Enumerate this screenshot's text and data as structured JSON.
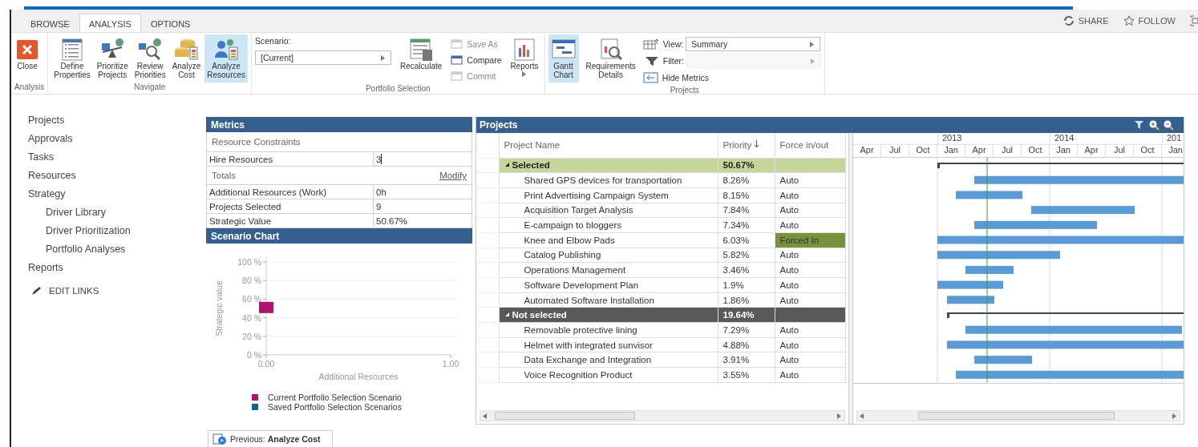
{
  "tabs": [
    {
      "label": "BROWSE",
      "selected": false
    },
    {
      "label": "ANALYSIS",
      "selected": true
    },
    {
      "label": "OPTIONS",
      "selected": false
    }
  ],
  "top_actions": [
    {
      "label": "SHARE"
    },
    {
      "label": "FOLLOW"
    }
  ],
  "ribbon": {
    "analysis": {
      "label": "Analysis",
      "close": "Close"
    },
    "navigate": {
      "label": "Navigate",
      "items": [
        {
          "label": "Define\nProperties",
          "selected": false
        },
        {
          "label": "Prioritize\nProjects",
          "selected": false
        },
        {
          "label": "Review\nPriorities",
          "selected": false
        },
        {
          "label": "Analyze\nCost",
          "selected": false
        },
        {
          "label": "Analyze\nResources",
          "selected": true
        }
      ]
    },
    "portfolio": {
      "label": "Portfolio Selection",
      "scenario_label": "Scenario:",
      "scenario_value": "[Current]",
      "recalculate": "Recalculate",
      "actions": [
        {
          "label": "Save As",
          "disabled": true
        },
        {
          "label": "Compare",
          "disabled": false
        },
        {
          "label": "Commit",
          "disabled": true
        }
      ],
      "reports": "Reports"
    },
    "projects": {
      "label": "Projects",
      "views": [
        {
          "label": "Gantt\nChart",
          "selected": true
        },
        {
          "label": "Requirements\nDetails",
          "selected": false
        }
      ],
      "view_label": "View:",
      "view_value": "Summary",
      "filter_label": "Filter:",
      "filter_disabled": true,
      "hide_metrics": "Hide Metrics"
    }
  },
  "sidebar": {
    "items": [
      {
        "label": "Projects"
      },
      {
        "label": "Approvals"
      },
      {
        "label": "Tasks"
      },
      {
        "label": "Resources"
      },
      {
        "label": "Strategy",
        "children": [
          {
            "label": "Driver Library"
          },
          {
            "label": "Driver Prioritization"
          },
          {
            "label": "Portfolio Analyses"
          }
        ]
      },
      {
        "label": "Reports"
      }
    ],
    "edit_links": "EDIT LINKS"
  },
  "metrics": {
    "title": "Metrics",
    "constraints_title": "Resource Constraints",
    "constraint": {
      "label": "Hire Resources",
      "value": "3"
    },
    "totals_title": "Totals",
    "modify": "Modify",
    "totals": [
      {
        "label": "Additional Resources (Work)",
        "value": "0h"
      },
      {
        "label": "Projects Selected",
        "value": "9"
      },
      {
        "label": "Strategic Value",
        "value": "50.67%"
      }
    ]
  },
  "scenario_chart": {
    "title": "Scenario Chart",
    "chart_data": {
      "type": "scatter",
      "xlabel": "Additional Resources",
      "ylabel": "Strategic value",
      "x": [
        0
      ],
      "series": [
        {
          "name": "Current Portfolio Selection Scenario",
          "color": "#b0136b",
          "values": [
            51
          ]
        },
        {
          "name": "Saved Portfolio Selection Scenarios",
          "color": "#1b5f8c",
          "values": [
            null
          ]
        }
      ],
      "grid": true,
      "xlim": [
        0,
        1
      ],
      "ylim": [
        0,
        100
      ],
      "xticks": [
        {
          "value": 0,
          "label": "0.00"
        },
        {
          "value": 1,
          "label": "1.00"
        }
      ],
      "yticks": [
        {
          "value": 0,
          "label": "0 %"
        },
        {
          "value": 20,
          "label": "20 %"
        },
        {
          "value": 40,
          "label": "40 %"
        },
        {
          "value": 60,
          "label": "60 %"
        },
        {
          "value": 80,
          "label": "80 %"
        },
        {
          "value": 100,
          "label": "100 %"
        }
      ]
    }
  },
  "previous_button": "Previous: **Analyze Cost**",
  "projects_panel": {
    "title": "Projects",
    "columns": [
      {
        "label": "Project Name",
        "sorted": false
      },
      {
        "label": "Priority",
        "sorted": true
      },
      {
        "label": "Force in/out",
        "sorted": false
      }
    ],
    "groups": [
      {
        "kind": "selected",
        "name": "Selected",
        "priority": "50.67%",
        "expanded": true,
        "rows": [
          {
            "name": "Shared GPS devices for transportation",
            "priority": "8.26%",
            "force": "Auto",
            "forced": false
          },
          {
            "name": "Print Advertising Campaign System",
            "priority": "8.15%",
            "force": "Auto",
            "forced": false
          },
          {
            "name": "Acquisition Target Analysis",
            "priority": "7.84%",
            "force": "Auto",
            "forced": false
          },
          {
            "name": "E-campaign to bloggers",
            "priority": "7.34%",
            "force": "Auto",
            "forced": false
          },
          {
            "name": "Knee and Elbow Pads",
            "priority": "6.03%",
            "force": "Forced In",
            "forced": true
          },
          {
            "name": "Catalog Publishing",
            "priority": "5.82%",
            "force": "Auto",
            "forced": false
          },
          {
            "name": "Operations Management",
            "priority": "3.46%",
            "force": "Auto",
            "forced": false
          },
          {
            "name": "Software Development Plan",
            "priority": "1.9%",
            "force": "Auto",
            "forced": false
          },
          {
            "name": "Automated Software Installation",
            "priority": "1.86%",
            "force": "Auto",
            "forced": false
          }
        ]
      },
      {
        "kind": "not_selected",
        "name": "Not selected",
        "priority": "19.64%",
        "expanded": true,
        "rows": [
          {
            "name": "Removable protective lining",
            "priority": "7.29%",
            "force": "Auto",
            "forced": false
          },
          {
            "name": "Helmet with integrated sunvisor",
            "priority": "4.88%",
            "force": "Auto",
            "forced": false
          },
          {
            "name": "Data Exchange and Integration",
            "priority": "3.91%",
            "force": "Auto",
            "forced": false
          },
          {
            "name": "Voice Recognition Product",
            "priority": "3.55%",
            "force": "Auto",
            "forced": false
          }
        ]
      }
    ],
    "gantt": {
      "years": [
        "2013",
        "2014",
        "201"
      ],
      "months": [
        "Apr",
        "Jul",
        "Oct",
        "Jan",
        "Apr",
        "Jul",
        "Oct",
        "Jan",
        "Apr",
        "Jul",
        "Oct",
        "Jan"
      ]
    }
  }
}
